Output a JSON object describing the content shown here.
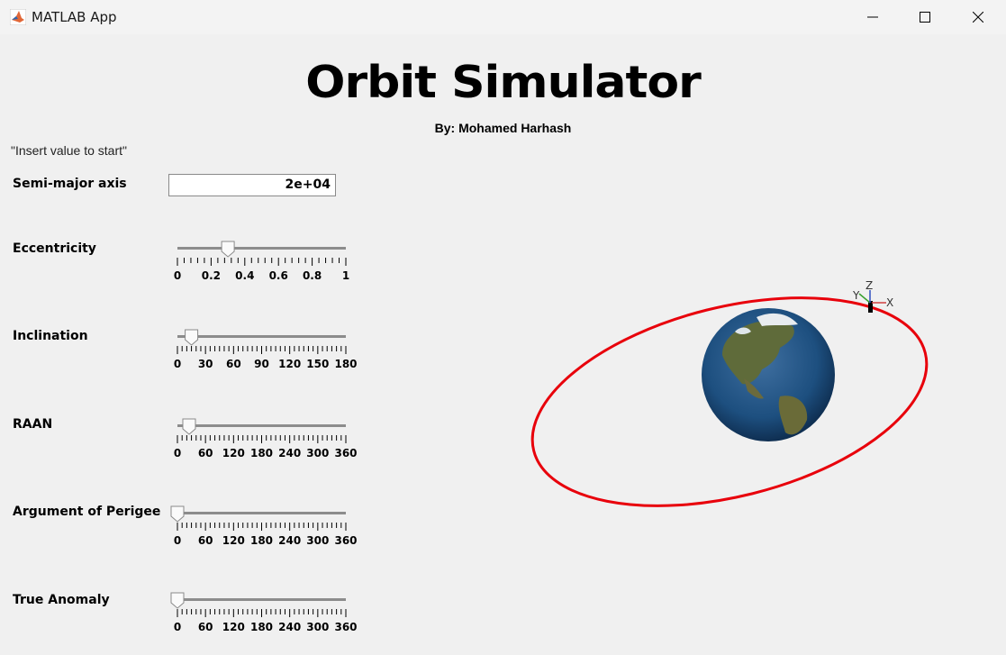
{
  "window": {
    "title": "MATLAB App",
    "icon": "matlab-icon"
  },
  "header": {
    "title": "Orbit Simulator",
    "author": "By: Mohamed Harhash"
  },
  "hint": "\"Insert value to start\"",
  "semi_major_axis": {
    "label": "Semi-major axis",
    "value": "2e+04"
  },
  "sliders": [
    {
      "label": "Eccentricity",
      "min": 0,
      "max": 1,
      "value": 0.3,
      "ticks": [
        "0",
        "0.2",
        "0.4",
        "0.6",
        "0.8",
        "1"
      ],
      "minor": 25
    },
    {
      "label": "Inclination",
      "min": 0,
      "max": 180,
      "value": 15,
      "ticks": [
        "0",
        "30",
        "60",
        "90",
        "120",
        "150",
        "180"
      ],
      "minor": 36
    },
    {
      "label": "RAAN",
      "min": 0,
      "max": 360,
      "value": 25,
      "ticks": [
        "0",
        "60",
        "120",
        "180",
        "240",
        "300",
        "360"
      ],
      "minor": 36
    },
    {
      "label": "Argument of Perigee",
      "min": 0,
      "max": 360,
      "value": 0,
      "ticks": [
        "0",
        "60",
        "120",
        "180",
        "240",
        "300",
        "360"
      ],
      "minor": 36
    },
    {
      "label": "True Anomaly",
      "min": 0,
      "max": 360,
      "value": 0,
      "ticks": [
        "0",
        "60",
        "120",
        "180",
        "240",
        "300",
        "360"
      ],
      "minor": 36
    }
  ],
  "plot": {
    "orbit_color": "#e8000b",
    "axes_labels": [
      "X",
      "Y",
      "Z"
    ]
  }
}
